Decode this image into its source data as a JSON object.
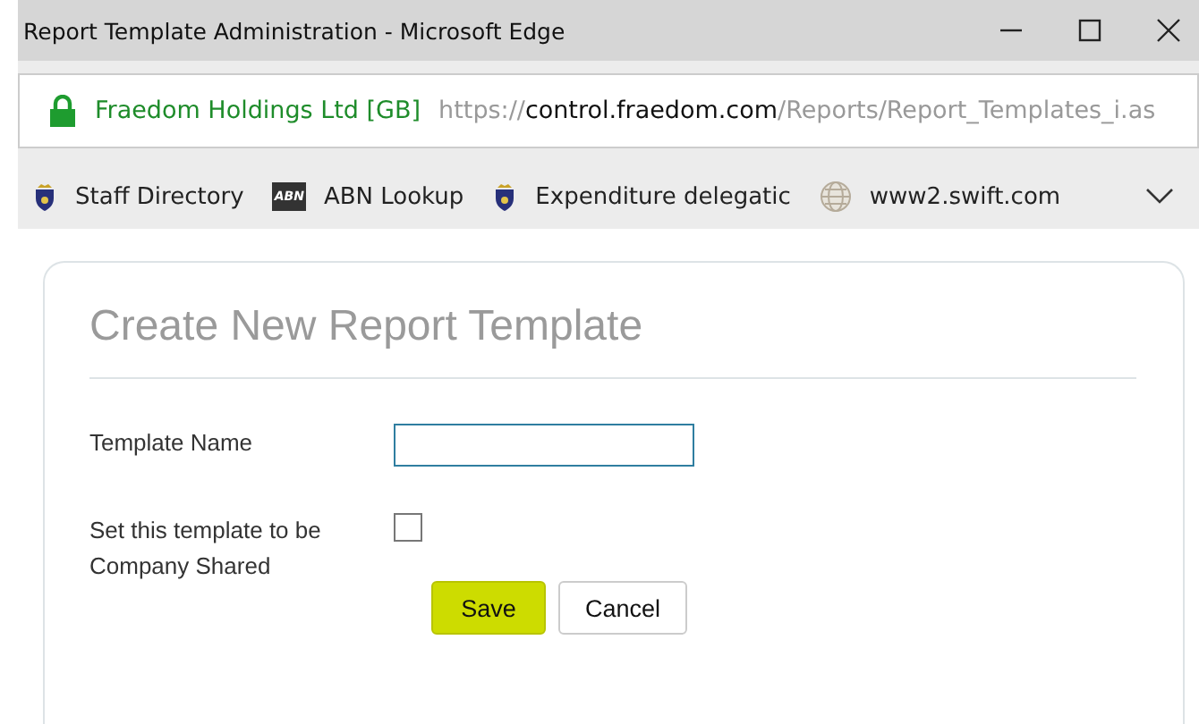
{
  "window": {
    "title": "Report Template Administration - Microsoft Edge"
  },
  "address_bar": {
    "site_identity": "Fraedom Holdings Ltd [GB]",
    "secure": true,
    "url_scheme": "https://",
    "url_host": "control.fraedom.com",
    "url_path": "/Reports/Report_Templates_i.as"
  },
  "bookmarks": [
    {
      "kind": "crest",
      "label": "Staff Directory"
    },
    {
      "kind": "tile",
      "icon_text": "ABN",
      "label": "ABN Lookup"
    },
    {
      "kind": "crest",
      "label": "Expenditure delegatic"
    },
    {
      "kind": "globe",
      "label": "www2.swift.com"
    }
  ],
  "form": {
    "title": "Create New Report Template",
    "fields": [
      {
        "kind": "text",
        "label": "Template Name",
        "focused": true
      },
      {
        "kind": "checkbox",
        "label": "Set this template to be Company Shared",
        "checked": false
      }
    ],
    "buttons": [
      {
        "label": "Save",
        "primary": true
      },
      {
        "label": "Cancel",
        "primary": false
      }
    ]
  }
}
